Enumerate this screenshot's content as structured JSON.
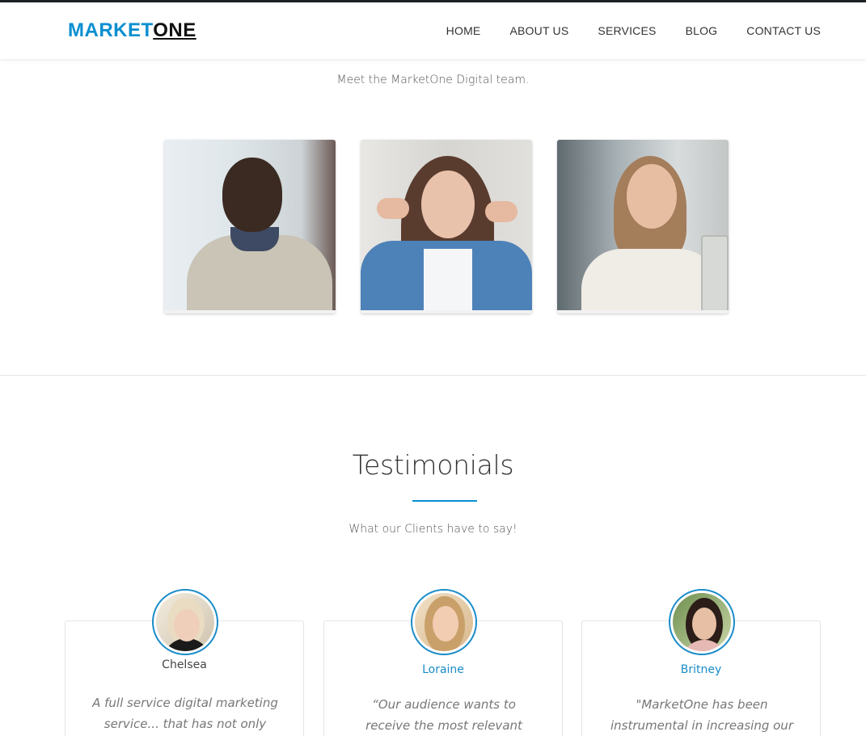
{
  "header": {
    "logo_part1": "MARKET",
    "logo_part2": "ONE",
    "nav": [
      "HOME",
      "ABOUT US",
      "SERVICES",
      "BLOG",
      "CONTACT US"
    ]
  },
  "team": {
    "subtitle": "Meet the MarketOne Digital team."
  },
  "testimonials": {
    "title": "Testimonials",
    "subtitle": "What our Clients have to say!",
    "items": [
      {
        "name": "Chelsea",
        "quote": "A full service digital marketing service... that has not only"
      },
      {
        "name": "Loraine",
        "quote": "“Our audience wants to receive the most relevant information"
      },
      {
        "name": "Britney",
        "quote": "\"MarketOne has been instrumental in increasing our"
      }
    ]
  },
  "colors": {
    "accent": "#0a8fd0",
    "topbar": "#1e2227"
  }
}
